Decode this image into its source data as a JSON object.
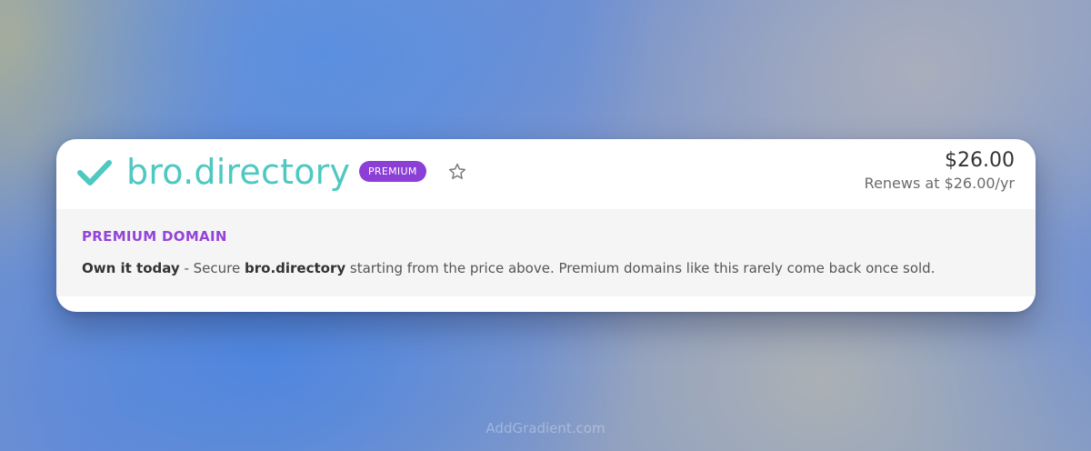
{
  "domain": {
    "name": "bro.directory",
    "badge": "PREMIUM",
    "status_icon": "check-icon",
    "favorite_icon": "star-icon"
  },
  "pricing": {
    "price": "$26.00",
    "renews": "Renews at $26.00/yr"
  },
  "details": {
    "section_title": "PREMIUM DOMAIN",
    "lead": "Own it today",
    "separator": " - Secure ",
    "domain_ref": "bro.directory",
    "tail": " starting from the price above. Premium domains like this rarely come back once sold."
  },
  "watermark": "AddGradient.com",
  "colors": {
    "domain_teal": "#4fc8c2",
    "premium_purple": "#8b3fd6",
    "section_purple": "#9444d8"
  }
}
